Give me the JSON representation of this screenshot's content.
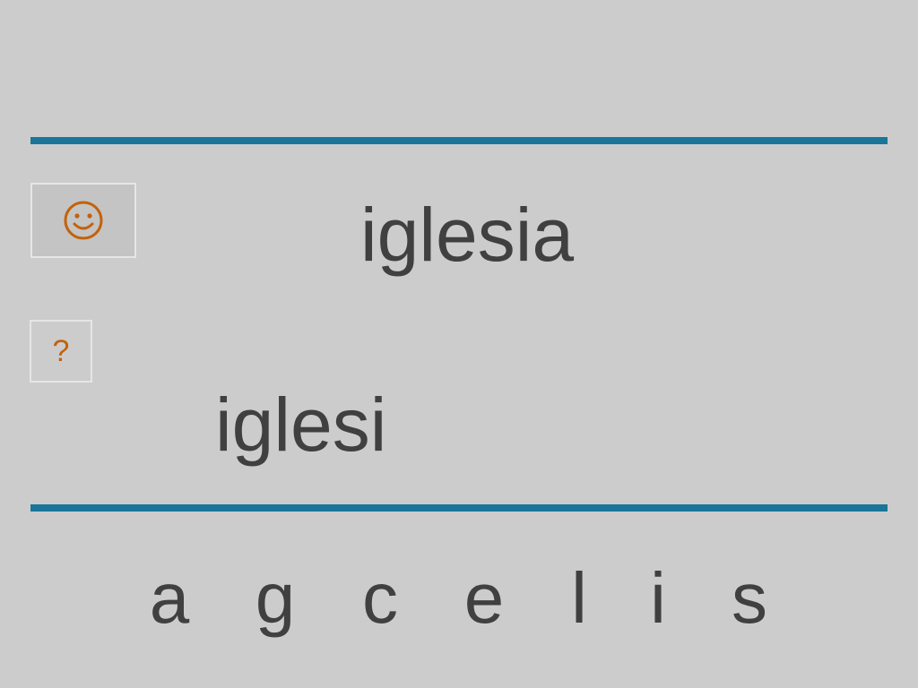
{
  "target_word": "iglesia",
  "answer": "iglesi",
  "hint_label": "?",
  "letters": [
    "a",
    "g",
    "c",
    "e",
    "l",
    "i",
    "s"
  ],
  "colors": {
    "background": "#cccccc",
    "divider": "#1a7599",
    "text": "#404040",
    "icon_accent": "#c2620a"
  },
  "icons": {
    "feedback": "smiley-icon"
  }
}
